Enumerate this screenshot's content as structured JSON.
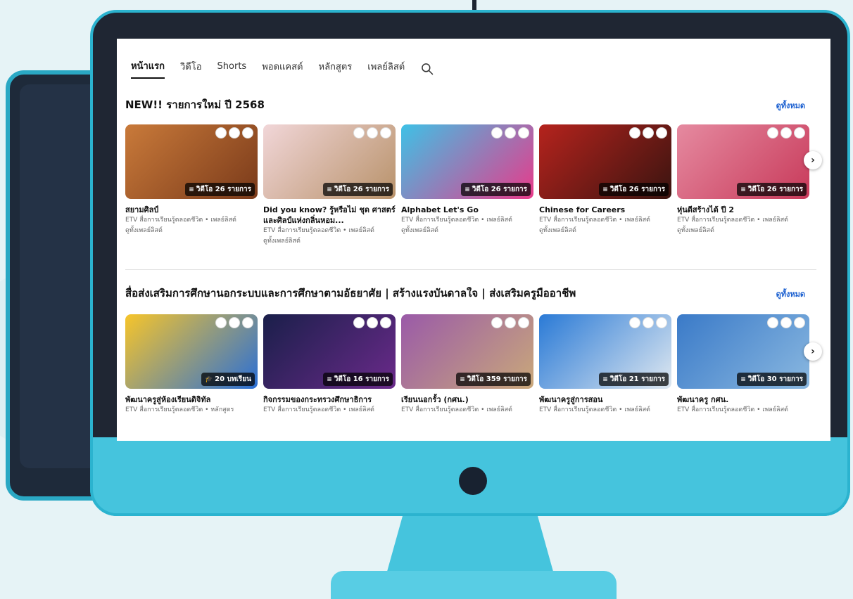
{
  "colors": {
    "accent": "#1a5fd0",
    "monitor_frame": "#45c4dd",
    "monitor_body": "#1f2633",
    "background": "#e6f3f6"
  },
  "nav": {
    "tabs": [
      "หน้าแรก",
      "วิดีโอ",
      "Shorts",
      "พอดแคสต์",
      "หลักสูตร",
      "เพลย์ลิสต์"
    ],
    "active_tab": "หน้าแรก",
    "search_icon": "search-icon"
  },
  "sections": [
    {
      "title": "NEW!! รายการใหม่ ปี 2568",
      "see_all": "ดูทั้งหมด",
      "cards": [
        {
          "title": "สยามศิลป์",
          "meta": "ETV สื่อการเรียนรู้ตลอดชีวิต • เพลย์ลิสต์",
          "link": "ดูทั้งเพลย์ลิสต์",
          "badge": "วิดีโอ 26 รายการ",
          "colors": [
            "#c97a3a",
            "#7a3a1a"
          ]
        },
        {
          "title": "Did you know? รู้หรือไม่ ชุด ศาสตร์และศิลป์แห่งกลิ่นหอม...",
          "meta": "ETV สื่อการเรียนรู้ตลอดชีวิต • เพลย์ลิสต์",
          "link": "ดูทั้งเพลย์ลิสต์",
          "badge": "วิดีโอ 26 รายการ",
          "colors": [
            "#f1d6d8",
            "#b8926a"
          ]
        },
        {
          "title": "Alphabet Let's Go",
          "meta": "ETV สื่อการเรียนรู้ตลอดชีวิต • เพลย์ลิสต์",
          "link": "ดูทั้งเพลย์ลิสต์",
          "badge": "วิดีโอ 26 รายการ",
          "colors": [
            "#3ec1e6",
            "#e83a8a"
          ]
        },
        {
          "title": "Chinese for Careers",
          "meta": "ETV สื่อการเรียนรู้ตลอดชีวิต • เพลย์ลิสต์",
          "link": "ดูทั้งเพลย์ลิสต์",
          "badge": "วิดีโอ 26 รายการ",
          "colors": [
            "#b5231d",
            "#3a1410"
          ]
        },
        {
          "title": "หุ่นดีสร้างได้ ปี 2",
          "meta": "ETV สื่อการเรียนรู้ตลอดชีวิต • เพลย์ลิสต์",
          "link": "ดูทั้งเพลย์ลิสต์",
          "badge": "วิดีโอ 26 รายการ",
          "colors": [
            "#e58aa0",
            "#c83a5a"
          ]
        }
      ]
    },
    {
      "title": "สื่อส่งเสริมการศึกษานอกระบบและการศึกษาตามอัธยาศัย | สร้างแรงบันดาลใจ | ส่งเสริมครูมืออาชีพ",
      "see_all": "ดูทั้งหมด",
      "cards": [
        {
          "title": "พัฒนาครูสู่ห้องเรียนดิจิทัล",
          "meta": "ETV สื่อการเรียนรู้ตลอดชีวิต • หลักสูตร",
          "badge": "20 บทเรียน",
          "colors": [
            "#f7c52a",
            "#2a6fd6"
          ]
        },
        {
          "title": "กิจกรรมของกระทรวงศึกษาธิการ",
          "meta": "ETV สื่อการเรียนรู้ตลอดชีวิต • เพลย์ลิสต์",
          "badge": "วิดีโอ 16 รายการ",
          "colors": [
            "#1a1f4a",
            "#6a2a8a"
          ]
        },
        {
          "title": "เรียนนอกรั้ว (กศน.)",
          "meta": "ETV สื่อการเรียนรู้ตลอดชีวิต • เพลย์ลิสต์",
          "badge": "วิดีโอ 359 รายการ",
          "colors": [
            "#9a5aa8",
            "#c9a87a"
          ]
        },
        {
          "title": "พัฒนาครูสู่การสอน",
          "meta": "ETV สื่อการเรียนรู้ตลอดชีวิต • เพลย์ลิสต์",
          "badge": "วิดีโอ 21 รายการ",
          "colors": [
            "#2a7ad6",
            "#dfe8f0"
          ]
        },
        {
          "title": "พัฒนาครู กศน.",
          "meta": "ETV สื่อการเรียนรู้ตลอดชีวิต • เพลย์ลิสต์",
          "badge": "วิดีโอ 30 รายการ",
          "colors": [
            "#3a7ac8",
            "#8ab8e0"
          ]
        }
      ]
    }
  ]
}
